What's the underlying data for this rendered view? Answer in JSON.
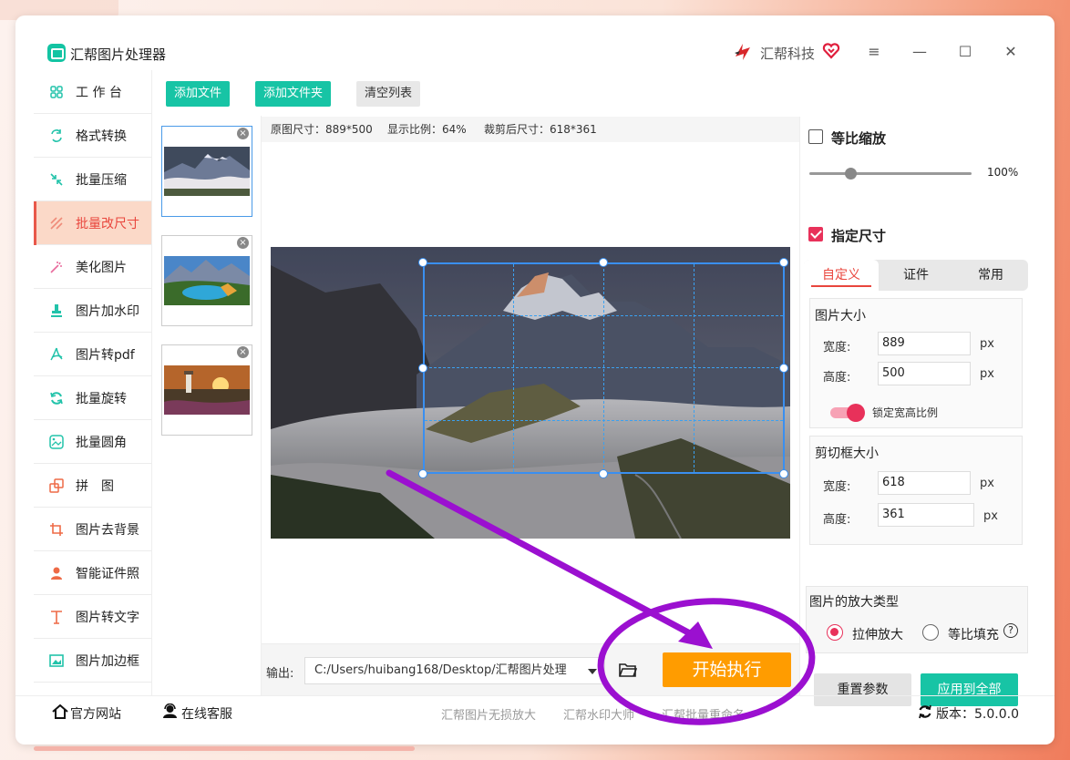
{
  "app": {
    "title": "汇帮图片处理器",
    "brand": "汇帮科技"
  },
  "window_controls": {
    "menu": "≡",
    "minimize": "—",
    "maximize": "☐",
    "close": "✕"
  },
  "sidebar": {
    "items": [
      {
        "label": "工 作 台",
        "icon": "grid-icon"
      },
      {
        "label": "格式转换",
        "icon": "convert-icon"
      },
      {
        "label": "批量压缩",
        "icon": "compress-icon"
      },
      {
        "label": "批量改尺寸",
        "icon": "resize-icon",
        "active": true
      },
      {
        "label": "美化图片",
        "icon": "beautify-icon"
      },
      {
        "label": "图片加水印",
        "icon": "watermark-icon"
      },
      {
        "label": "图片转pdf",
        "icon": "pdf-icon"
      },
      {
        "label": "批量旋转",
        "icon": "rotate-icon"
      },
      {
        "label": "批量圆角",
        "icon": "round-corner-icon"
      },
      {
        "label": "拼　图",
        "icon": "collage-icon"
      },
      {
        "label": "图片去背景",
        "icon": "remove-bg-icon"
      },
      {
        "label": "智能证件照",
        "icon": "id-photo-icon"
      },
      {
        "label": "图片转文字",
        "icon": "text-icon"
      },
      {
        "label": "图片加边框",
        "icon": "border-icon"
      }
    ]
  },
  "toolbar": {
    "add_file": "添加文件",
    "add_folder": "添加文件夹",
    "clear_list": "清空列表"
  },
  "info_bar": {
    "original": "原图尺寸：889*500",
    "ratio": "显示比例：64%",
    "cropped": "裁剪后尺寸：618*361"
  },
  "output": {
    "label": "输出:",
    "path": "C:/Users/huibang168/Desktop/汇帮图片处理",
    "start": "开始执行"
  },
  "right_panel": {
    "proportional": {
      "label": "等比缩放",
      "checked": false,
      "percent_text": "100%",
      "slider_value": 0.25
    },
    "specify": {
      "label": "指定尺寸",
      "checked": true
    },
    "tabs": [
      "自定义",
      "证件",
      "常用"
    ],
    "image_size": {
      "title": "图片大小",
      "width_label": "宽度:",
      "width": "889",
      "height_label": "高度:",
      "height": "500",
      "unit": "px",
      "lock_label": "锁定宽高比例"
    },
    "crop_size": {
      "title": "剪切框大小",
      "width_label": "宽度:",
      "width": "618",
      "height_label": "高度:",
      "height": "361",
      "unit": "px"
    },
    "enlarge": {
      "title": "图片的放大类型",
      "stretch": "拉伸放大",
      "fill": "等比填充"
    },
    "reset": "重置参数",
    "apply_all": "应用到全部"
  },
  "status": {
    "website": "官方网站",
    "support": "在线客服",
    "links": [
      "汇帮图片无损放大",
      "汇帮水印大师",
      "汇帮批量重命名"
    ],
    "version": "版本：5.0.0.0"
  },
  "colors": {
    "accent_teal": "#17c4a5",
    "accent_red": "#e9463d",
    "start_orange": "#ff9c00",
    "annotation_purple": "#9b10d0"
  }
}
